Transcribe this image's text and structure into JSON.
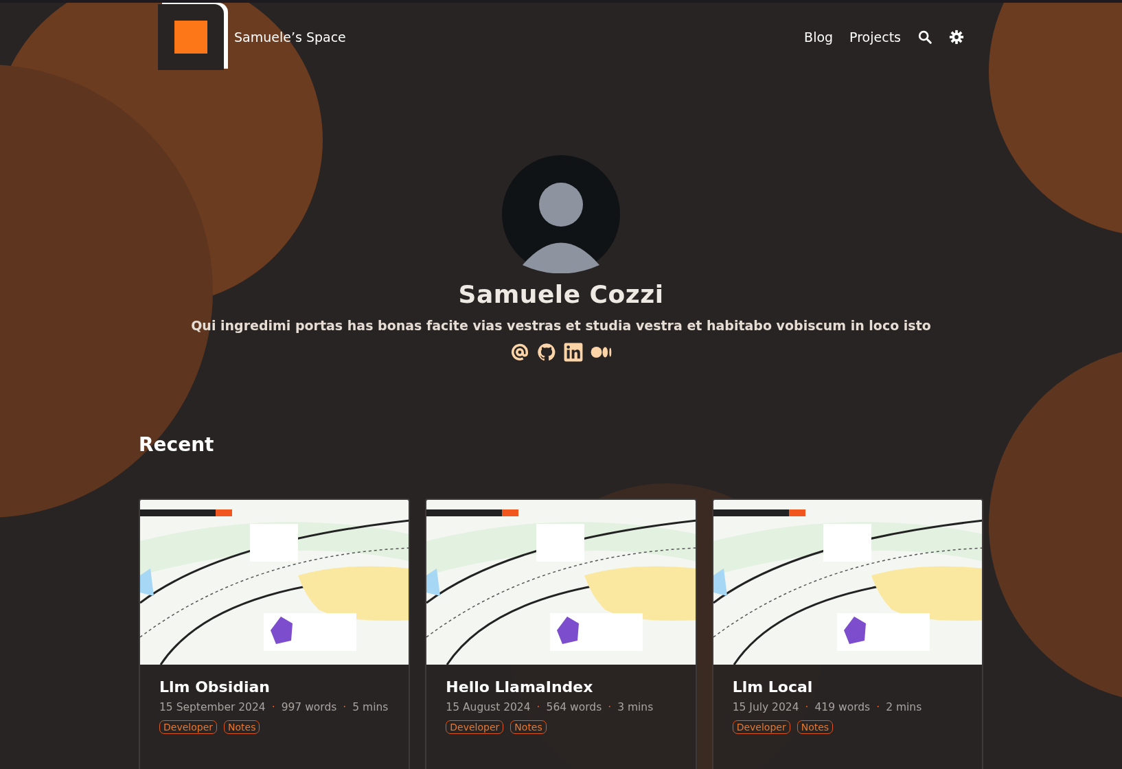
{
  "header": {
    "site_title": "Samuele’s Space",
    "nav": [
      {
        "label": "Blog"
      },
      {
        "label": "Projects"
      }
    ]
  },
  "profile": {
    "name": "Samuele Cozzi",
    "tagline": "Qui ingredimi portas has bonas facite vias vestras et studia vestra et habitabo vobiscum in loco isto"
  },
  "recent": {
    "heading": "Recent",
    "posts": [
      {
        "title": "Llm Obsidian",
        "meta": [
          "15 September 2024",
          "997 words",
          "5 mins"
        ],
        "separator": "·",
        "tags": [
          "Developer",
          "Notes"
        ],
        "image": {
          "kind": "picture"
        }
      },
      {
        "title": "Hello LlamaIndex",
        "meta": [
          "15 August 2024",
          "564 words",
          "3 mins"
        ],
        "separator": "·",
        "tags": [
          "Developer",
          "Notes"
        ],
        "image": {
          "kind": "picture"
        }
      },
      {
        "title": "Llm Local",
        "meta": [
          "15 July 2024",
          "419 words",
          "2 mins"
        ],
        "separator": "·",
        "tags": [
          "Developer",
          "Notes"
        ],
        "image": {
          "kind": "picture"
        }
      }
    ]
  }
}
